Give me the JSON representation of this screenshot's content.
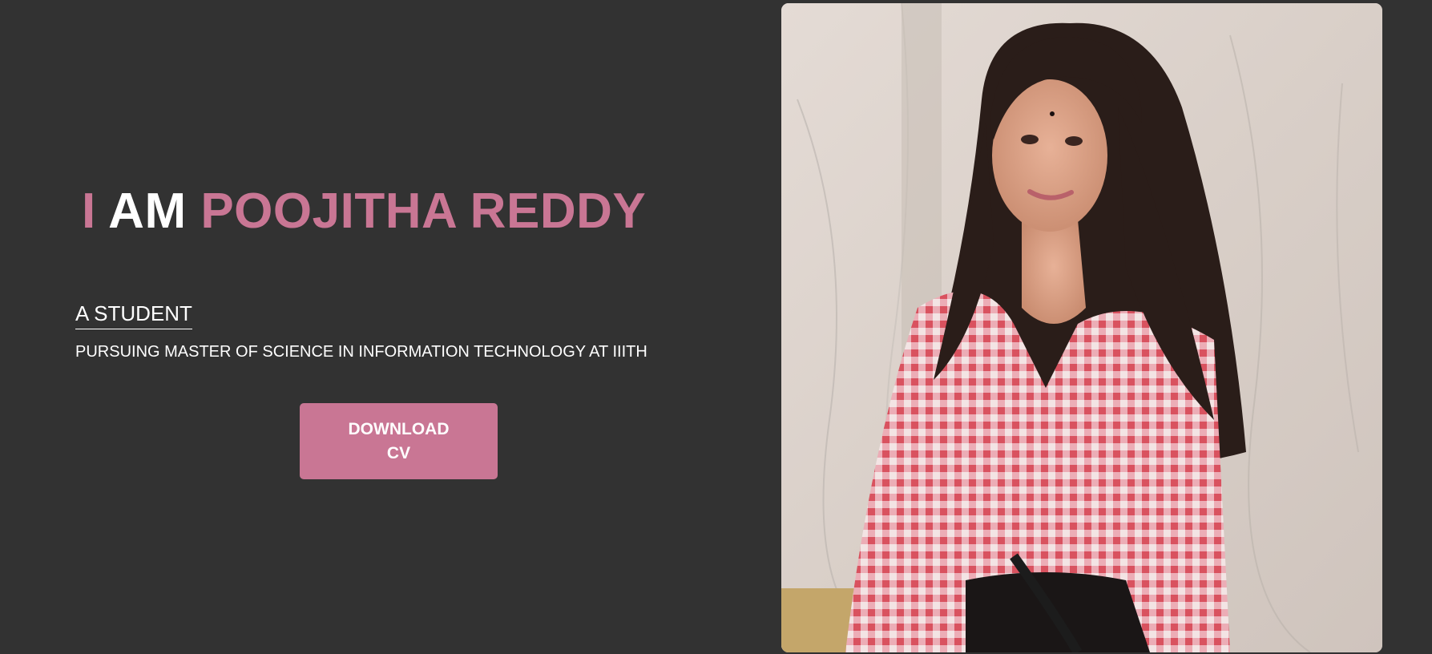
{
  "hero": {
    "word_i": "I",
    "word_am": "AM",
    "name": "POOJITHA REDDY",
    "role": "A STUDENT",
    "subtitle": "PURSUING MASTER OF SCIENCE IN INFORMATION TECHNOLOGY AT IIITH",
    "cv_button_label": "DOWNLOAD CV"
  },
  "photo": {
    "alt": "Poojitha Reddy"
  },
  "colors": {
    "background": "#323232",
    "accent": "#c97694",
    "text": "#ffffff"
  }
}
